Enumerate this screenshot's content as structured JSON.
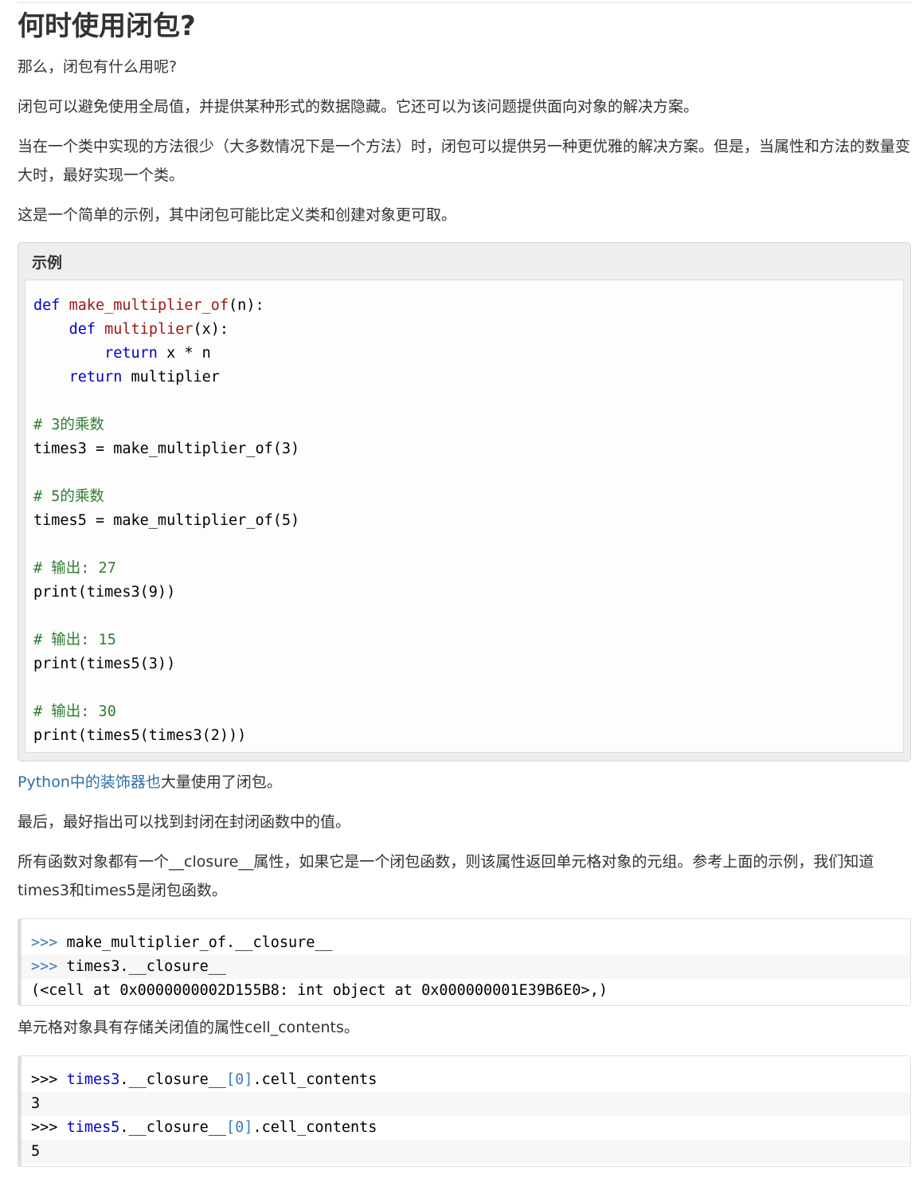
{
  "heading": "何时使用闭包?",
  "intro_question": "那么，闭包有什么用呢?",
  "para_benefits": "闭包可以避免使用全局值，并提供某种形式的数据隐藏。它还可以为该问题提供面向对象的解决方案。",
  "para_when": "当在一个类中实现的方法很少（大多数情况下是一个方法）时，闭包可以提供另一种更优雅的解决方案。但是，当属性和方法的数量变大时，最好实现一个类。",
  "para_example_intro": "这是一个简单的示例，其中闭包可能比定义类和创建对象更可取。",
  "example": {
    "title": "示例",
    "code": {
      "l1_kw": "def",
      "l1_fn": "make_multiplier_of",
      "l1_rest": "(n):",
      "l2_indent": "    ",
      "l2_kw": "def",
      "l2_fn": "multiplier",
      "l2_rest": "(x):",
      "l3_indent": "        ",
      "l3_kw": "return",
      "l3_rest": " x * n",
      "l4_indent": "    ",
      "l4_kw": "return",
      "l4_rest": " multiplier",
      "c1": "# 3的乘数",
      "l5": "times3 = make_multiplier_of(3)",
      "c2": "# 5的乘数",
      "l6": "times5 = make_multiplier_of(5)",
      "c3": "# 输出: 27",
      "l7": "print(times3(9))",
      "c4": "# 输出: 15",
      "l8": "print(times5(3))",
      "c5": "# 输出: 30",
      "l9": "print(times5(times3(2)))"
    }
  },
  "decorator_link": "Python中的装饰器也",
  "decorator_rest": "大量使用了闭包。",
  "para_finally": "最后，最好指出可以找到封闭在封闭函数中的值。",
  "para_closure_attr": "所有函数对象都有一个__closure__属性，如果它是一个闭包函数，则该属性返回单元格对象的元组。参考上面的示例，我们知道times3和times5是闭包函数。",
  "shell1": {
    "prompt": ">>>",
    "cmd1": " make_multiplier_of.__closure__",
    "cmd2": " times3.__closure__",
    "output": "(<cell at 0x0000000002D155B8: int object at 0x000000001E39B6E0>,)"
  },
  "para_cell": "单元格对象具有存储关闭值的属性cell_contents。",
  "shell2": {
    "prompt": ">>> ",
    "id1": "times3",
    "mid": ".__closure__",
    "idx": "[0]",
    "attr": ".cell_contents",
    "out1": "3",
    "id2": "times5",
    "out2": "5"
  }
}
